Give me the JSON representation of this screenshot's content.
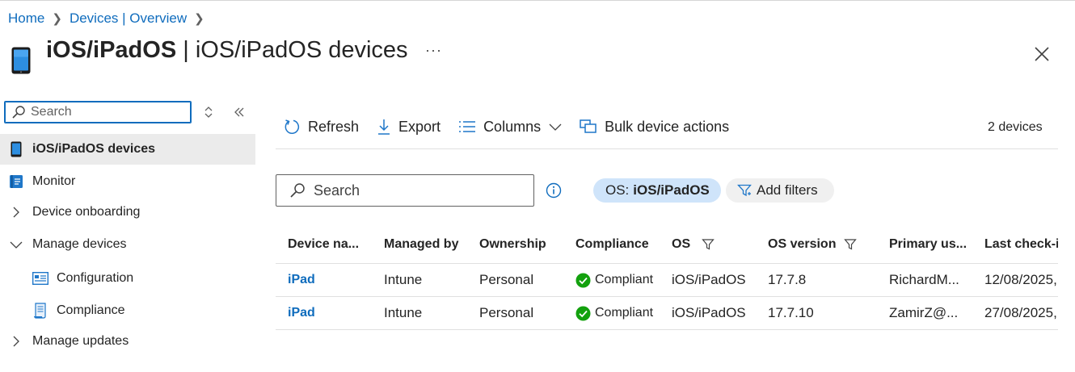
{
  "breadcrumb": {
    "home": "Home",
    "devices": "Devices | Overview"
  },
  "title": {
    "bold": "iOS/iPadOS",
    "rest": " | iOS/iPadOS devices",
    "more": "···"
  },
  "sidebar": {
    "search_placeholder": "Search",
    "items": [
      {
        "label": "iOS/iPadOS devices",
        "icon": "tablet-icon",
        "active": true
      },
      {
        "label": "Monitor",
        "icon": "monitor-book-icon"
      },
      {
        "label": "Device onboarding",
        "icon": "chevron-right-icon"
      },
      {
        "label": "Manage devices",
        "icon": "chevron-down-icon"
      },
      {
        "label": "Configuration",
        "icon": "configuration-icon"
      },
      {
        "label": "Compliance",
        "icon": "compliance-icon"
      },
      {
        "label": "Manage updates",
        "icon": "chevron-right-icon"
      }
    ]
  },
  "toolbar": {
    "refresh": "Refresh",
    "export": "Export",
    "columns": "Columns",
    "bulk": "Bulk device actions",
    "count": "2 devices"
  },
  "filters": {
    "search_placeholder": "Search",
    "os_label": "OS:",
    "os_value": "iOS/iPadOS",
    "add_filters": "Add filters"
  },
  "table": {
    "columns": [
      "Device na...",
      "Managed by",
      "Ownership",
      "Compliance",
      "OS",
      "OS version",
      "Primary us...",
      "Last check-in"
    ],
    "rows": [
      {
        "name": "iPad",
        "managed_by": "Intune",
        "ownership": "Personal",
        "compliance": "Compliant",
        "os": "iOS/iPadOS",
        "os_version": "17.7.8",
        "primary_user": "RichardM...",
        "last_checkin": "12/08/2025,"
      },
      {
        "name": "iPad",
        "managed_by": "Intune",
        "ownership": "Personal",
        "compliance": "Compliant",
        "os": "iOS/iPadOS",
        "os_version": "17.7.10",
        "primary_user": "ZamirZ@...",
        "last_checkin": "27/08/2025,"
      }
    ]
  },
  "colors": {
    "accent": "#0f6cbd",
    "compliant": "#13a10e",
    "pill": "#cfe4fa",
    "active_nav": "#ebebeb"
  }
}
